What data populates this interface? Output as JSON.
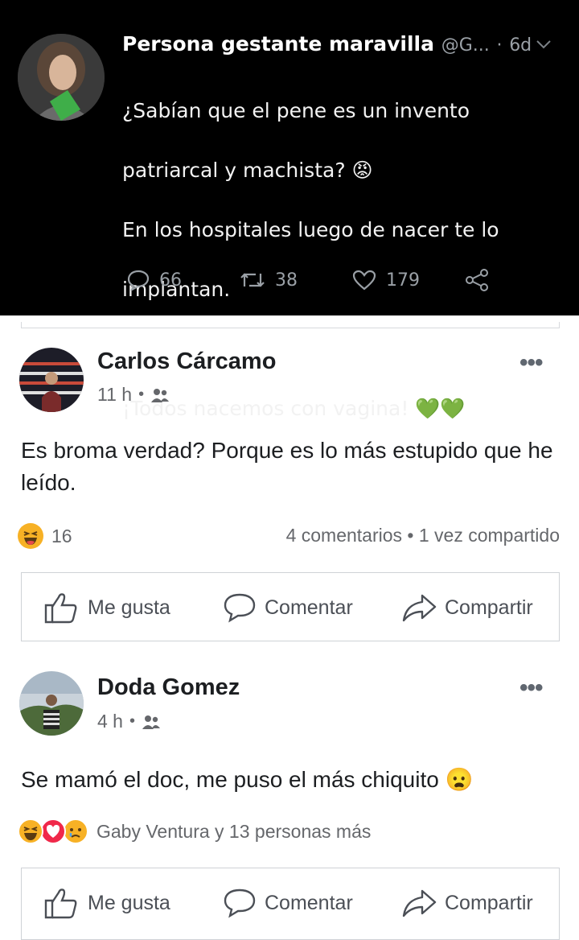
{
  "tweet": {
    "display_name": "Persona gestante maravilla",
    "handle": "@G...",
    "separator": "·",
    "age": "6d",
    "lines": [
      "¿Sabían que el pene es un invento",
      "patriarcal y machista? 😡",
      "En los hospitales luego de nacer te lo",
      "implantan.",
      "",
      "¡Todos nacemos con vagina! 💚💚"
    ],
    "replies": "66",
    "retweets": "38",
    "likes": "179",
    "colors": {
      "background": "#000000",
      "text": "#f2f2f2",
      "muted": "#9aa0a6",
      "heart_green": "#4cd137"
    }
  },
  "comments": [
    {
      "author": "Carlos Cárcamo",
      "time": "11 h",
      "audience_icon": "friends-icon",
      "text": "Es broma verdad? Porque es lo más estupido que he leído.",
      "reaction_icons": [
        "haha-icon"
      ],
      "reaction_count": "16",
      "stats": "4 comentarios • 1 vez compartido",
      "actions": {
        "like": "Me gusta",
        "comment": "Comentar",
        "share": "Compartir"
      }
    },
    {
      "author": "Doda Gomez",
      "time": "4 h",
      "audience_icon": "friends-icon",
      "text": "Se mamó el doc, me puso el más chiquito 😦",
      "reaction_icons": [
        "haha-icon",
        "love-icon",
        "sad-icon"
      ],
      "reaction_text": "Gaby Ventura y 13 personas más",
      "actions": {
        "like": "Me gusta",
        "comment": "Comentar",
        "share": "Compartir"
      }
    }
  ],
  "more_label": "•••",
  "dot": "•"
}
